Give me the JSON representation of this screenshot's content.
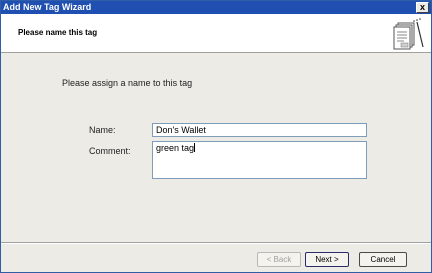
{
  "window": {
    "title": "Add New Tag Wizard",
    "close_glyph": "x"
  },
  "header": {
    "title": "Please name this tag",
    "icon": "wizard-pages-icon"
  },
  "body": {
    "intro": "Please assign a name to this tag",
    "name_label": "Name:",
    "name_value": "Don's Wallet",
    "comment_label": "Comment:",
    "comment_value": "green tag"
  },
  "buttons": {
    "back": "< Back",
    "next": "Next >",
    "cancel": "Cancel"
  }
}
